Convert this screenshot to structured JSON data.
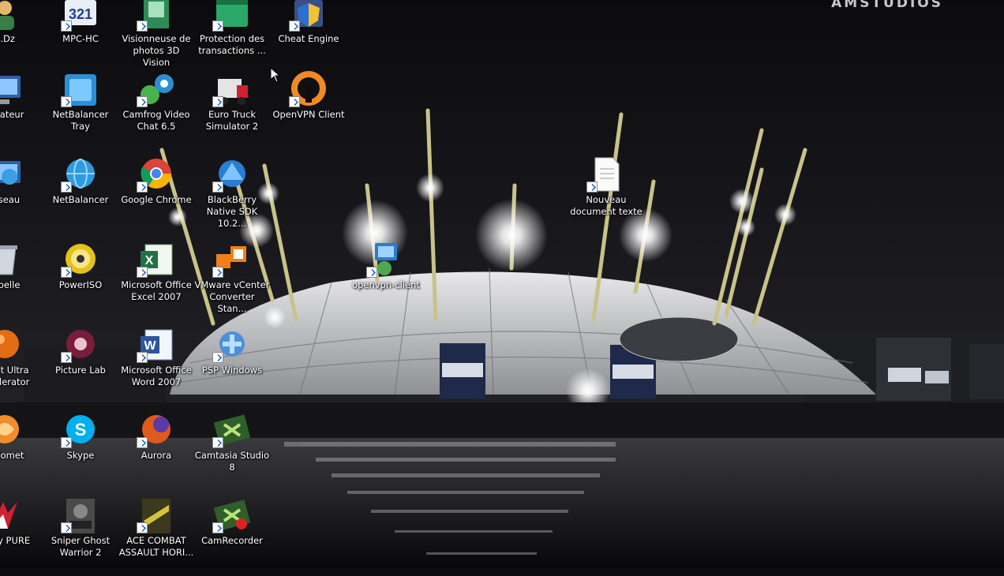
{
  "watermark": "AMSTUDIOS",
  "icons": [
    {
      "label": "...Dz",
      "kind": "partial-people"
    },
    {
      "label": "MPC-HC",
      "kind": "mpc"
    },
    {
      "label": "Visionneuse de photos 3D Vision",
      "kind": "green-doc"
    },
    {
      "label": "Protection des transactions ...",
      "kind": "green-shield"
    },
    {
      "label": "Cheat Engine",
      "kind": "cheat"
    },
    {
      "label": "...nateur",
      "kind": "monitor"
    },
    {
      "label": "NetBalancer Tray",
      "kind": "netbalancer-tray"
    },
    {
      "label": "Camfrog Video Chat 6.5",
      "kind": "camfrog"
    },
    {
      "label": "Euro Truck Simulator 2",
      "kind": "truck"
    },
    {
      "label": "OpenVPN Client",
      "kind": "openvpn"
    },
    {
      "label": "...seau",
      "kind": "network"
    },
    {
      "label": "NetBalancer",
      "kind": "globe"
    },
    {
      "label": "Google Chrome",
      "kind": "chrome"
    },
    {
      "label": "BlackBerry Native SDK 10.2...",
      "kind": "blackberry"
    },
    {
      "label": "...belle",
      "kind": "bin"
    },
    {
      "label": "PowerISO",
      "kind": "disc"
    },
    {
      "label": "Microsoft Office Excel 2007",
      "kind": "excel"
    },
    {
      "label": "VMware vCenter Converter Stan...",
      "kind": "vmware"
    },
    {
      "label": "...net Ultra ...celerator",
      "kind": "orange-ball"
    },
    {
      "label": "Picture Lab",
      "kind": "flower"
    },
    {
      "label": "Microsoft Office Word 2007",
      "kind": "word"
    },
    {
      "label": "PSP Windows",
      "kind": "psp"
    },
    {
      "label": "...Comet",
      "kind": "comet"
    },
    {
      "label": "Skype",
      "kind": "skype"
    },
    {
      "label": "Aurora",
      "kind": "aurora"
    },
    {
      "label": "Camtasia Studio 8",
      "kind": "camtasia"
    },
    {
      "label": "...sky PURE",
      "kind": "kaspersky"
    },
    {
      "label": "Sniper Ghost Warrior 2",
      "kind": "sniper"
    },
    {
      "label": "ACE COMBAT ASSAULT HORI...",
      "kind": "ace"
    },
    {
      "label": "CamRecorder",
      "kind": "camrecorder"
    },
    {
      "label": "Nouveau document texte",
      "kind": "textdoc"
    },
    {
      "label": "openvpn-client",
      "kind": "openvpn-client"
    }
  ]
}
